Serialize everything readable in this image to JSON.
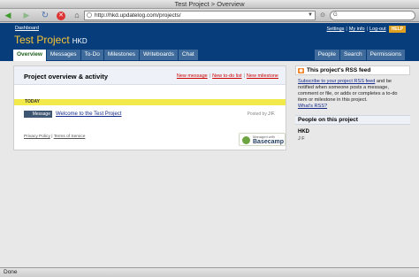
{
  "window": {
    "title": "Test Project > Overview"
  },
  "browser": {
    "url": "http://hkd.updatelog.com/projects/",
    "search_placeholder": "G"
  },
  "header": {
    "dashboard_link": "Dashboard",
    "project_name": "Test Project",
    "company": "HKD",
    "links": {
      "settings": "Settings",
      "my_info": "My info",
      "logout": "Log-out",
      "help": "HELP"
    }
  },
  "tabs": [
    "Overview",
    "Messages",
    "To-Do",
    "Milestones",
    "Writeboards",
    "Chat"
  ],
  "tabs_right": [
    "People",
    "Search",
    "Permissions"
  ],
  "main": {
    "title": "Project overview & activity",
    "actions": {
      "new_message": "New message",
      "new_todo": "New to-do list",
      "new_milestone": "New milestone"
    },
    "today_label": "TODAY",
    "item": {
      "type": "Message",
      "title": "Welcome to the Test Project",
      "posted_by_label": "Posted by",
      "author": "J F."
    }
  },
  "footer": {
    "privacy": "Privacy Policy",
    "terms": "Terms of Service",
    "logo_top": "Managed with",
    "logo_name": "Basecamp"
  },
  "sidebar": {
    "rss_title": "This project's RSS feed",
    "rss_link": "Subscribe to your project RSS feed",
    "rss_text": " and be notified when someone posts a message, comment or file, or adds or completes a to-do item or milestone in this project.",
    "rss_whatis": "What's RSS?",
    "people_title": "People on this project",
    "company": "HKD",
    "person": "J F"
  },
  "status_bar": "Done",
  "colors": {
    "header_bg": "#083d7c",
    "title_yellow": "#f7c634",
    "today_yellow": "#f2e94a"
  }
}
